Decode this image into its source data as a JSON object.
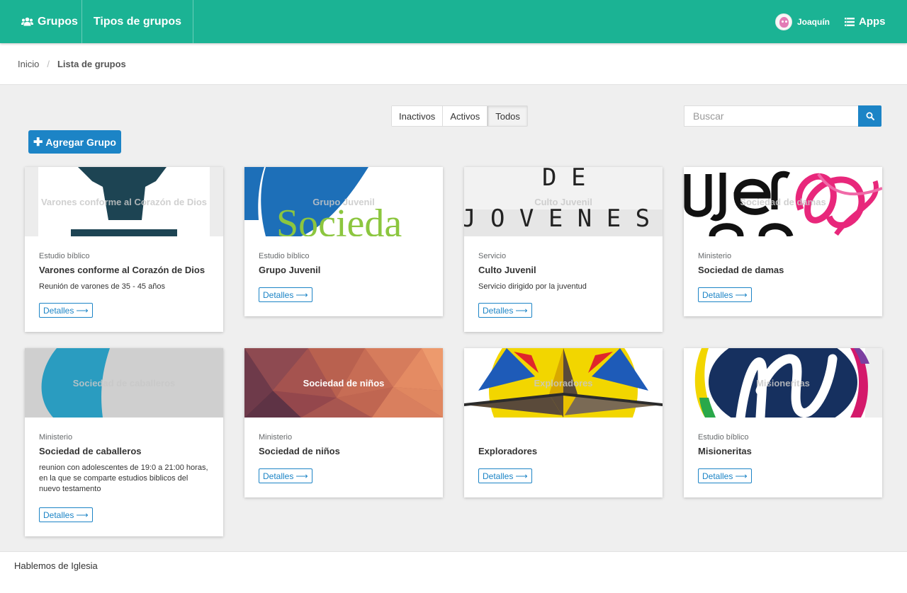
{
  "nav": {
    "groups_label": "Grupos",
    "types_label": "Tipos de grupos",
    "user_name": "Joaquín",
    "apps_label": "Apps"
  },
  "breadcrumb": {
    "home": "Inicio",
    "separator": "/",
    "current": "Lista de grupos"
  },
  "filters": {
    "options": [
      "Inactivos",
      "Activos",
      "Todos"
    ],
    "selected": "Todos"
  },
  "search": {
    "placeholder": "Buscar"
  },
  "add_button": {
    "label": "Agregar Grupo"
  },
  "cards": [
    {
      "overlay_title": "Varones conforme al Corazón de Dios",
      "category": "Estudio bíblico",
      "title": "Varones conforme al Corazón de Dios",
      "description": "Reunión de varones de 35 - 45 años",
      "button": "Detalles"
    },
    {
      "overlay_title": "Grupo Juvenil",
      "category": "Estudio bíblico",
      "title": "Grupo Juvenil",
      "description": "",
      "button": "Detalles",
      "image_text": "Socieda"
    },
    {
      "overlay_title": "Culto Juvenil",
      "category": "Servicio",
      "title": "Culto Juvenil",
      "description": "Servicio dirigido por la juventud",
      "button": "Detalles",
      "image_text_top": "D E",
      "image_text_bottom": "J O V E N E S"
    },
    {
      "overlay_title": "Sociedad de damas",
      "category": "Ministerio",
      "title": "Sociedad de damas",
      "description": "",
      "button": "Detalles"
    },
    {
      "overlay_title": "Sociedad de caballeros",
      "category": "Ministerio",
      "title": "Sociedad de caballeros",
      "description": "reunion con adolescentes de 19:0 a 21:00 horas, en la que se comparte estudios biblicos del nuevo testamento",
      "button": "Detalles"
    },
    {
      "overlay_title": "Sociedad de niños",
      "category": "Ministerio",
      "title": "Sociedad de niños",
      "description": "",
      "button": "Detalles"
    },
    {
      "overlay_title": "Exploradores",
      "category": "",
      "title": "Exploradores",
      "description": "",
      "button": "Detalles"
    },
    {
      "overlay_title": "Misioneritas",
      "category": "Estudio bíblico",
      "title": "Misioneritas",
      "description": "",
      "button": "Detalles"
    }
  ],
  "footer": {
    "text": "Hablemos de Iglesia"
  },
  "colors": {
    "primary": "#1bb394",
    "accent": "#1c84c6"
  }
}
